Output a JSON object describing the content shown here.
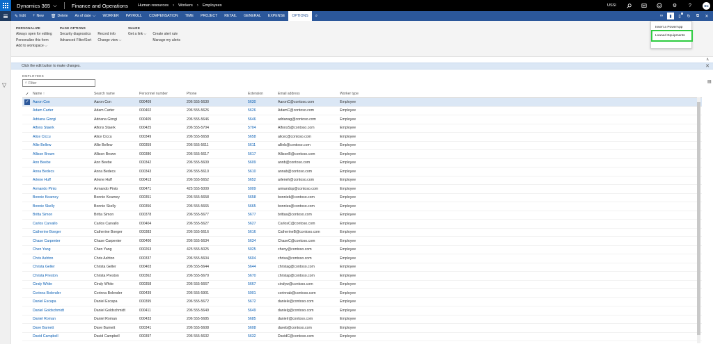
{
  "topbar": {
    "brand": "Dynamics 365",
    "app_name": "Finance and Operations",
    "breadcrumbs": [
      "Human resources",
      "Workers",
      "Employees"
    ],
    "company": "USSI",
    "user_initials": "SC"
  },
  "actionbar": {
    "buttons": [
      {
        "label": "Edit",
        "icon": "pencil-icon"
      },
      {
        "label": "New",
        "icon": "plus-icon"
      },
      {
        "label": "Delete",
        "icon": "trash-icon"
      },
      {
        "label": "As of date",
        "icon": "chevron-down-icon"
      }
    ],
    "tabs": [
      "WORKER",
      "PAYROLL",
      "COMPENSATION",
      "TIME",
      "PROJECT",
      "RETAIL",
      "GENERAL",
      "EXPENSE",
      "OPTIONS"
    ],
    "active_tab": "OPTIONS"
  },
  "ribbon": {
    "personalize": {
      "title": "PERSONALIZE",
      "items": [
        "Always open for editing",
        "Personalize this form",
        "Add to workspace"
      ]
    },
    "page_options": {
      "title": "PAGE OPTIONS",
      "col1": [
        "Security diagnostics",
        "Advanced Filter/Sort"
      ],
      "col2": [
        "Record info",
        "Change view"
      ]
    },
    "share": {
      "title": "SHARE",
      "col1": [
        "Get a link"
      ],
      "col2": [
        "Create alert rule",
        "Manage my alerts"
      ]
    }
  },
  "dropdown": {
    "items": [
      "Insert a PowerApp",
      "Loaned Equipments"
    ],
    "highlight_color": "#2ecc40"
  },
  "infobar": {
    "message": "Click the edit button to make changes."
  },
  "grid": {
    "title": "EMPLOYEES",
    "filter_placeholder": "Filter",
    "columns": [
      "Name",
      "Search name",
      "Personnel number",
      "Phone",
      "Extension",
      "Email address",
      "Worker type"
    ],
    "rows": [
      [
        "Aaron Con",
        "Aaron Con",
        "000409",
        "206 555-5630",
        "5630",
        "AaronC@contoso.com",
        "Employee"
      ],
      [
        "Adam Carter",
        "Adam Carter",
        "000402",
        "206 555-5626",
        "5626",
        "AdamC@contoso.com",
        "Employee"
      ],
      [
        "Adriana Giorgi",
        "Adriana Giorgi",
        "000405",
        "206 555-5646",
        "5646",
        "adrianag@contoso.com",
        "Employee"
      ],
      [
        "Alfons Staerk",
        "Alfons Staerk",
        "000425",
        "206 555-5704",
        "5704",
        "AlfonsS@contoso.com",
        "Employee"
      ],
      [
        "Alice Ciccu",
        "Alice Ciccu",
        "000349",
        "206 555-5658",
        "5658",
        "alicec@contoso.com",
        "Employee"
      ],
      [
        "Allie Bellew",
        "Allie Bellew",
        "000359",
        "206 555-5611",
        "5611",
        "allieb@contoso.com",
        "Employee"
      ],
      [
        "Allison Brown",
        "Allison Brown",
        "000386",
        "206 555-5617",
        "5617",
        "AllisonB@contoso.com",
        "Employee"
      ],
      [
        "Ann Beebe",
        "Ann Beebe",
        "000342",
        "206 555-5609",
        "5609",
        "annb@contoso.com",
        "Employee"
      ],
      [
        "Anna Bedecs",
        "Anna Bedecs",
        "000343",
        "206 555-5610",
        "5610",
        "annab@contoso.com",
        "Employee"
      ],
      [
        "Arlene Huff",
        "Arlene Huff",
        "000413",
        "206 555-5652",
        "5652",
        "arleneh@contoso.com",
        "Employee"
      ],
      [
        "Armando Pinto",
        "Armando Pinto",
        "000471",
        "425 555-5009",
        "5009",
        "armandop@contoso.com",
        "Employee"
      ],
      [
        "Bonnie Kearney",
        "Bonnie Kearney",
        "000351",
        "206 555-5658",
        "5658",
        "bonniek@contoso.com",
        "Employee"
      ],
      [
        "Bonnie Skelly",
        "Bonnie Skelly",
        "000356",
        "206 555-5665",
        "5665",
        "bonnies@contoso.com",
        "Employee"
      ],
      [
        "Britta Simon",
        "Britta Simon",
        "000378",
        "206 555-5677",
        "5677",
        "brittas@contoso.com",
        "Employee"
      ],
      [
        "Carlos Carvallo",
        "Carlos Carvallo",
        "000404",
        "206 555-5627",
        "5627",
        "CarlosC@contoso.com",
        "Employee"
      ],
      [
        "Catherine Boeger",
        "Catherine Boeger",
        "000383",
        "206 555-5616",
        "5616",
        "CatherineB@contoso.com",
        "Employee"
      ],
      [
        "Chase Carpenter",
        "Chase Carpenter",
        "000400",
        "206 555-5634",
        "5634",
        "ChaseC@contoso.com",
        "Employee"
      ],
      [
        "Chen Yang",
        "Chen Yang",
        "000263",
        "425 555-5025",
        "5025",
        "cheny@contoso.com",
        "Employee"
      ],
      [
        "Chris Ashton",
        "Chris Ashton",
        "000337",
        "206 555-5604",
        "5604",
        "chrisa@contoso.com",
        "Employee"
      ],
      [
        "Christa Geller",
        "Christa Geller",
        "000403",
        "206 555-5644",
        "5644",
        "christag@contoso.com",
        "Employee"
      ],
      [
        "Christa Preston",
        "Christa Preston",
        "000362",
        "206 555-5670",
        "5670",
        "christap@contoso.com",
        "Employee"
      ],
      [
        "Cindy White",
        "Cindy White",
        "000358",
        "206 555-5667",
        "5667",
        "cindyw@contoso.com",
        "Employee"
      ],
      [
        "Corinna Bolender",
        "Corinna Bolender",
        "000439",
        "206 555-5901",
        "5901",
        "corinnab@contoso.com",
        "Employee"
      ],
      [
        "Daniel Escapa",
        "Daniel Escapa",
        "000395",
        "206 555-5672",
        "5672",
        "daniele@contoso.com",
        "Employee"
      ],
      [
        "Daniel Goldschmidt",
        "Daniel Goldschmidt",
        "000411",
        "206 555-5649",
        "5649",
        "danielg@contoso.com",
        "Employee"
      ],
      [
        "Daniel Roman",
        "Daniel Roman",
        "000433",
        "206 555-5685",
        "5685",
        "danielr@contoso.com",
        "Employee"
      ],
      [
        "Dave Barnett",
        "Dave Barnett",
        "000341",
        "206 555-5608",
        "5608",
        "daveb@contoso.com",
        "Employee"
      ],
      [
        "David Campbell",
        "David Campbell",
        "000397",
        "206 555-5632",
        "5632",
        "DavidC@contoso.com",
        "Employee"
      ]
    ],
    "selected_row": 0
  },
  "colors": {
    "topbar": "#000000",
    "actionbar": "#2b579a",
    "link": "#0b5fb3",
    "selected_row": "#dbe7f5"
  }
}
